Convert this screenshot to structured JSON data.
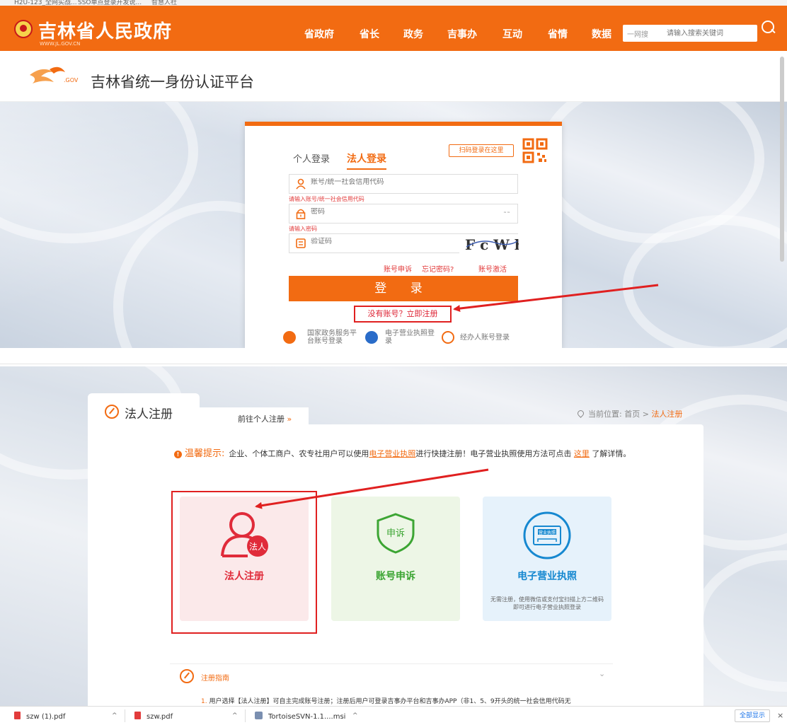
{
  "bookmarks": [
    "H2U-123_全网实战...",
    "SSO单点登录开发说...",
    "智慧人社"
  ],
  "header": {
    "site_title": "吉林省人民政府",
    "site_domain": "WWW.JL.GOV.CN",
    "nav": [
      "省政府",
      "省长",
      "政务",
      "吉事办",
      "互动",
      "省情",
      "数据"
    ],
    "search_scope": "一网搜",
    "search_placeholder": "请输入搜索关键词"
  },
  "platform": {
    "logo_text": ".GOV",
    "title": "吉林省统一身份认证平台"
  },
  "login": {
    "tabs": [
      "个人登录",
      "法人登录"
    ],
    "active_tab": "法人登录",
    "qr_hint": "扫码登录在这里",
    "account_placeholder": "账号/统一社会信用代码",
    "account_error": "请输入账号/统一社会信用代码",
    "password_placeholder": "密码",
    "password_error": "请输入密码",
    "captcha_placeholder": "验证码",
    "captcha_text": "F c W h",
    "links": [
      "账号申诉",
      "忘记密码?",
      "账号激活"
    ],
    "login_button": "登 录",
    "register_link": "没有账号？立即注册",
    "alt_logins": [
      "国家政务服务平台账号登录",
      "电子营业执照登录",
      "经办人账号登录"
    ]
  },
  "register": {
    "tab_title": "法人注册",
    "goto_personal": "前往个人注册",
    "goto_arrow": "»",
    "location_prefix": "当前位置:",
    "breadcrumb": [
      "首页",
      "法人注册"
    ],
    "tip_label": "温馨提示:",
    "tip_text_1": "企业、个体工商户、农专社用户可以使用",
    "tip_link_1": "电子营业执照",
    "tip_text_2": "进行快捷注册！电子营业执照使用方法可点击",
    "tip_link_2": "这里",
    "tip_text_3": "了解详情。",
    "tiles": [
      {
        "label": "法人注册",
        "badge": "法人",
        "color": "#e02b3a"
      },
      {
        "label": "账号申诉",
        "badge": "申诉",
        "color": "#3ca533"
      },
      {
        "label": "电子营业执照",
        "badge": "营业执照",
        "color": "#1688d0",
        "sub": "无需注册，使用微信或支付宝扫描上方二维码即可进行电子营业执照登录"
      }
    ],
    "guide_label": "注册指南",
    "guide_num": "1.",
    "guide_text": "用户选择【法人注册】可自主完成账号注册；注册后用户可登录吉事办平台和吉事办APP（非1、5、9开头的统一社会信用代码无"
  },
  "downloads": {
    "items": [
      "szw (1).pdf",
      "szw.pdf",
      "TortoiseSVN-1.1....msi"
    ],
    "show_all": "全部显示",
    "close": "×"
  }
}
